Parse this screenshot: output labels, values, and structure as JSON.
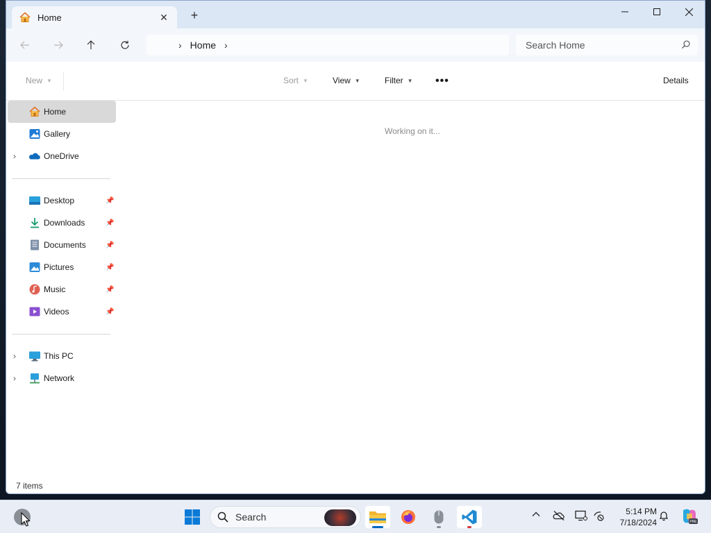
{
  "window": {
    "tab_title": "Home",
    "tab_close": "✕",
    "new_tab": "+",
    "controls": {
      "minimize": "—",
      "maximize": "☐",
      "close": "✕"
    }
  },
  "nav": {
    "breadcrumb": "Home",
    "search_placeholder": "Search Home"
  },
  "commands": {
    "new": "New",
    "sort": "Sort",
    "view": "View",
    "filter": "Filter",
    "more": "•••",
    "details": "Details"
  },
  "sidebar": {
    "quick": [
      {
        "label": "Home",
        "icon": "home-icon",
        "active": true
      },
      {
        "label": "Gallery",
        "icon": "gallery-icon"
      },
      {
        "label": "OneDrive",
        "icon": "onedrive-icon",
        "expandable": true
      }
    ],
    "pinned": [
      {
        "label": "Desktop",
        "icon": "desktop-folder-icon"
      },
      {
        "label": "Downloads",
        "icon": "downloads-icon"
      },
      {
        "label": "Documents",
        "icon": "documents-icon"
      },
      {
        "label": "Pictures",
        "icon": "pictures-icon"
      },
      {
        "label": "Music",
        "icon": "music-icon"
      },
      {
        "label": "Videos",
        "icon": "videos-icon"
      }
    ],
    "devices": [
      {
        "label": "This PC",
        "icon": "this-pc-icon",
        "expandable": true
      },
      {
        "label": "Network",
        "icon": "network-icon",
        "expandable": true
      }
    ]
  },
  "content": {
    "loading_text": "Working on it..."
  },
  "status": {
    "item_count": "7 items"
  },
  "taskbar": {
    "search_label": "Search",
    "time": "5:14 PM",
    "date": "7/18/2024"
  },
  "colors": {
    "accent": "#0067c0",
    "folder": "#f2b431",
    "titlebar": "#dbe7f5"
  }
}
